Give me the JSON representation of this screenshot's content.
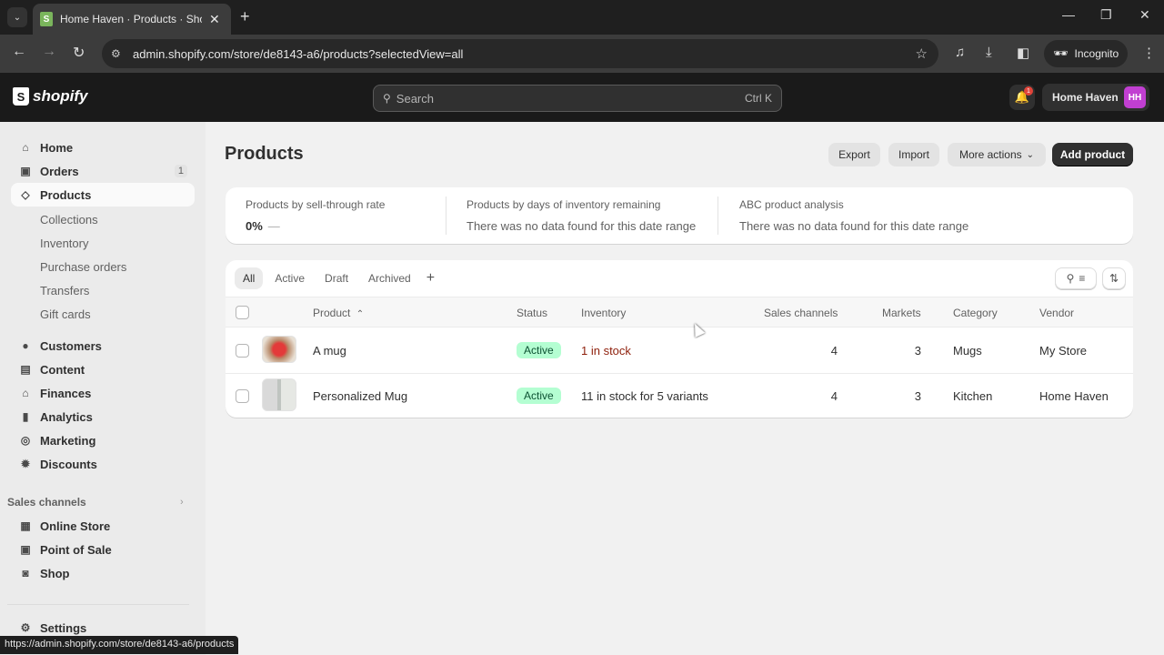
{
  "browser": {
    "tab_title": "Home Haven · Products · Shopify",
    "url": "admin.shopify.com/store/de8143-a6/products?selectedView=all",
    "incognito_label": "Incognito",
    "status_url": "https://admin.shopify.com/store/de8143-a6/products"
  },
  "topbar": {
    "logo_text": "shopify",
    "search_placeholder": "Search",
    "search_shortcut": "Ctrl K",
    "notification_count": "1",
    "store_name": "Home Haven",
    "avatar_initials": "HH",
    "avatar_color": "#c13fd1"
  },
  "sidebar": {
    "items": [
      {
        "label": "Home",
        "icon": "home-icon"
      },
      {
        "label": "Orders",
        "icon": "orders-icon",
        "badge": "1"
      },
      {
        "label": "Products",
        "icon": "tag-icon",
        "active": true
      }
    ],
    "product_subitems": [
      "Collections",
      "Inventory",
      "Purchase orders",
      "Transfers",
      "Gift cards"
    ],
    "items2": [
      {
        "label": "Customers",
        "icon": "person-icon"
      },
      {
        "label": "Content",
        "icon": "content-icon"
      },
      {
        "label": "Finances",
        "icon": "bank-icon"
      },
      {
        "label": "Analytics",
        "icon": "bar-chart-icon"
      },
      {
        "label": "Marketing",
        "icon": "target-icon"
      },
      {
        "label": "Discounts",
        "icon": "discount-icon"
      }
    ],
    "sales_channels_label": "Sales channels",
    "channels": [
      {
        "label": "Online Store",
        "icon": "store-icon"
      },
      {
        "label": "Point of Sale",
        "icon": "pos-icon"
      },
      {
        "label": "Shop",
        "icon": "shop-icon"
      }
    ],
    "settings_label": "Settings"
  },
  "page": {
    "title": "Products",
    "actions": {
      "export": "Export",
      "import": "Import",
      "more_actions": "More actions",
      "add_product": "Add product"
    },
    "analytics": [
      {
        "label": "Products by sell-through rate",
        "value": "0%",
        "trend": "—"
      },
      {
        "label": "Products by days of inventory remaining",
        "value": "There was no data found for this date range"
      },
      {
        "label": "ABC product analysis",
        "value": "There was no data found for this date range"
      }
    ],
    "tabs": [
      "All",
      "Active",
      "Draft",
      "Archived"
    ],
    "selected_tab": "All",
    "columns": {
      "product": "Product",
      "status": "Status",
      "inventory": "Inventory",
      "sales_channels": "Sales channels",
      "markets": "Markets",
      "category": "Category",
      "vendor": "Vendor"
    },
    "rows": [
      {
        "product": "A mug",
        "status": "Active",
        "inventory": "1 in stock",
        "inventory_low": true,
        "sales_channels": "4",
        "markets": "3",
        "category": "Mugs",
        "vendor": "My Store"
      },
      {
        "product": "Personalized Mug",
        "status": "Active",
        "inventory": "11 in stock for 5 variants",
        "inventory_low": false,
        "sales_channels": "4",
        "markets": "3",
        "category": "Kitchen",
        "vendor": "Home Haven"
      }
    ],
    "colors": {
      "status_active_bg": "#b4fed2",
      "low_stock_text": "#8e1f0b",
      "primary_button": "#303030"
    }
  }
}
